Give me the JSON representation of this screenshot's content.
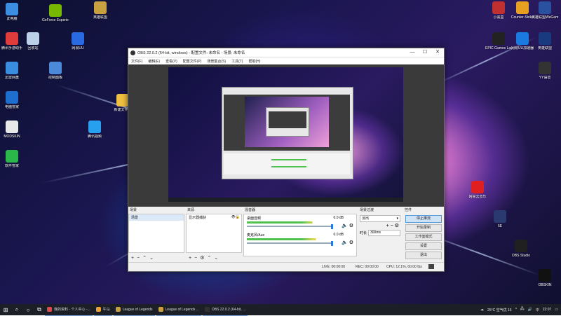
{
  "desktop": {
    "icons_left": [
      {
        "label": "此电脑",
        "color": "#3b8ee0"
      },
      {
        "label": "腾讯手游助手",
        "color": "#e03c3c"
      },
      {
        "label": "迅雷网盘",
        "color": "#3a8ee0"
      },
      {
        "label": "电脑管家",
        "color": "#1e6ed0"
      },
      {
        "label": "MODSKIN",
        "color": "#e8e8e8"
      },
      {
        "label": "软件管家",
        "color": "#2ab84a"
      }
    ],
    "icons_col2": [
      {
        "label": "GeForce Experience",
        "color": "#76b900"
      },
      {
        "label": "回收站",
        "color": "#bcd0e8"
      },
      {
        "label": "控制面板",
        "color": "#4a8ad8"
      }
    ],
    "icons_col3": [
      {
        "label": "英雄联盟",
        "color": "#c8a040"
      },
      {
        "label": "网易UU",
        "color": "#2a6ae0"
      },
      {
        "label": "腾讯视频",
        "color": "#28a0f0"
      },
      {
        "label": "新建文件夹",
        "color": "#f0c040"
      }
    ],
    "icons_right_top": [
      {
        "label": "小黑盒",
        "color": "#c03030"
      },
      {
        "label": "Counter-Strike",
        "color": "#e8a020"
      },
      {
        "label": "英雄联盟WeGame版",
        "color": "#2a50a0"
      }
    ],
    "icons_right_row2": [
      {
        "label": "EPIC Games Launcher",
        "color": "#222222"
      },
      {
        "label": "网易UU加速器",
        "color": "#1a7ae0"
      },
      {
        "label": "英雄联盟",
        "color": "#1a3a80"
      }
    ],
    "icons_right_col": [
      {
        "label": "YY语音",
        "color": "#333333"
      },
      {
        "label": "网易云音乐",
        "color": "#e02020"
      },
      {
        "label": "5E",
        "color": "#2a3a70"
      },
      {
        "label": "OBS Studio",
        "color": "#202020"
      },
      {
        "label": "OBSKIN",
        "color": "#111111"
      }
    ]
  },
  "obs": {
    "title": "OBS 22.0.2 (64-bit, windows) - 配置文件: 未命名 - 场景: 未命名",
    "menu": [
      "文件(F)",
      "编辑(E)",
      "查看(V)",
      "配置文件(P)",
      "场景集合(S)",
      "工具(T)",
      "帮助(H)"
    ],
    "docks": {
      "scenes": {
        "header": "场景",
        "items": [
          "场景"
        ]
      },
      "sources": {
        "header": "来源",
        "items": [
          "显示器捕获"
        ]
      },
      "mixer": {
        "header": "混音器",
        "channels": [
          {
            "name": "桌面音频",
            "db": "0.0 dB",
            "level": 0.78
          },
          {
            "name": "麦克风/Aux",
            "db": "0.0 dB",
            "level": 0.82
          }
        ]
      },
      "transitions": {
        "header": "场景过渡",
        "type": "淡出",
        "duration_label": "时长",
        "duration": "300ms"
      },
      "controls": {
        "header": "控件",
        "buttons": [
          "停止推流",
          "开始录制",
          "工作室模式",
          "设置",
          "退出"
        ]
      }
    },
    "status": {
      "live": "LIVE: 00:00:00",
      "rec": "REC: 00:00:00",
      "cpu": "CPU: 12.1%, 60.00 fps"
    }
  },
  "taskbar": {
    "apps": [
      {
        "label": "我的资料 - 个人中心 -...",
        "color": "#e04a4a"
      },
      {
        "label": "牛马",
        "color": "#f0a030"
      },
      {
        "label": "League of Legends",
        "color": "#c8a040"
      },
      {
        "label": "League of Legends ...",
        "color": "#c8a040"
      },
      {
        "label": "OBS 22.0.2 (64-bit, ...",
        "color": "#303030"
      }
    ],
    "weather": "25°C 空气优 15",
    "ime": "中",
    "time": "22:07"
  }
}
